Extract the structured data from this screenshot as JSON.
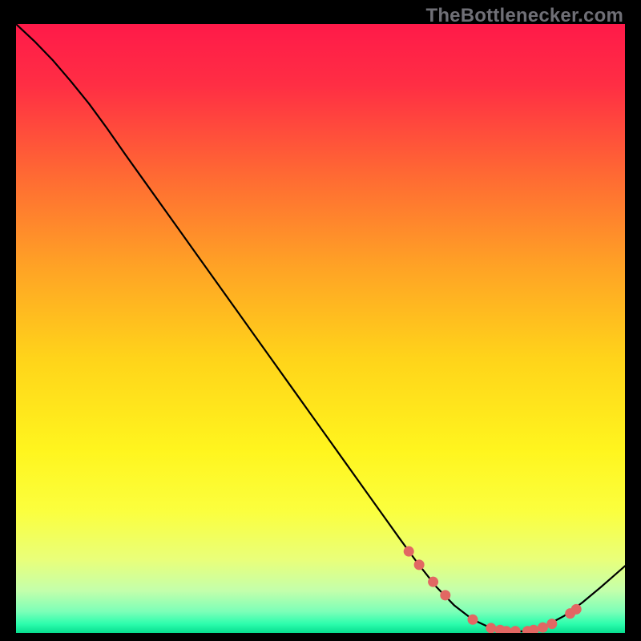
{
  "watermark": "TheBottlenecker.com",
  "chart_data": {
    "type": "line",
    "title": "",
    "xlabel": "",
    "ylabel": "",
    "xlim": [
      0,
      100
    ],
    "ylim": [
      0,
      100
    ],
    "grid": false,
    "background_gradient": {
      "stops": [
        {
          "offset": 0.0,
          "color": "#ff1a49"
        },
        {
          "offset": 0.1,
          "color": "#ff2e44"
        },
        {
          "offset": 0.25,
          "color": "#ff6a33"
        },
        {
          "offset": 0.4,
          "color": "#ffa325"
        },
        {
          "offset": 0.55,
          "color": "#ffd41a"
        },
        {
          "offset": 0.7,
          "color": "#fff51e"
        },
        {
          "offset": 0.8,
          "color": "#fbff3e"
        },
        {
          "offset": 0.88,
          "color": "#e9ff7a"
        },
        {
          "offset": 0.93,
          "color": "#c4ffab"
        },
        {
          "offset": 0.965,
          "color": "#7cffb8"
        },
        {
          "offset": 0.985,
          "color": "#2dfdad"
        },
        {
          "offset": 1.0,
          "color": "#07de8f"
        }
      ]
    },
    "series": [
      {
        "name": "bottleneck-curve",
        "color": "#000000",
        "x": [
          0,
          3,
          6,
          9,
          12,
          15,
          18,
          21,
          24,
          27,
          30,
          33,
          36,
          39,
          42,
          45,
          48,
          51,
          54,
          57,
          60,
          63,
          66,
          69,
          72,
          75,
          78,
          81,
          84,
          87,
          90,
          93,
          96,
          100
        ],
        "y": [
          100,
          97.2,
          94.1,
          90.6,
          86.9,
          82.8,
          78.5,
          74.3,
          70.1,
          65.9,
          61.7,
          57.5,
          53.3,
          49.1,
          44.9,
          40.7,
          36.5,
          32.3,
          28.1,
          23.9,
          19.7,
          15.5,
          11.4,
          7.6,
          4.5,
          2.2,
          0.8,
          0.2,
          0.3,
          1.2,
          2.8,
          5.0,
          7.5,
          11.0
        ]
      }
    ],
    "markers": {
      "name": "highlight-points",
      "color": "#e26763",
      "radius": 6.5,
      "x": [
        64.5,
        66.2,
        68.5,
        70.5,
        75.0,
        78.0,
        79.5,
        80.5,
        82.0,
        84.0,
        85.0,
        86.5,
        88.0,
        91.0,
        92.0
      ],
      "y": [
        13.4,
        11.2,
        8.4,
        6.2,
        2.2,
        0.8,
        0.5,
        0.3,
        0.3,
        0.3,
        0.5,
        0.9,
        1.5,
        3.2,
        3.9
      ]
    }
  }
}
